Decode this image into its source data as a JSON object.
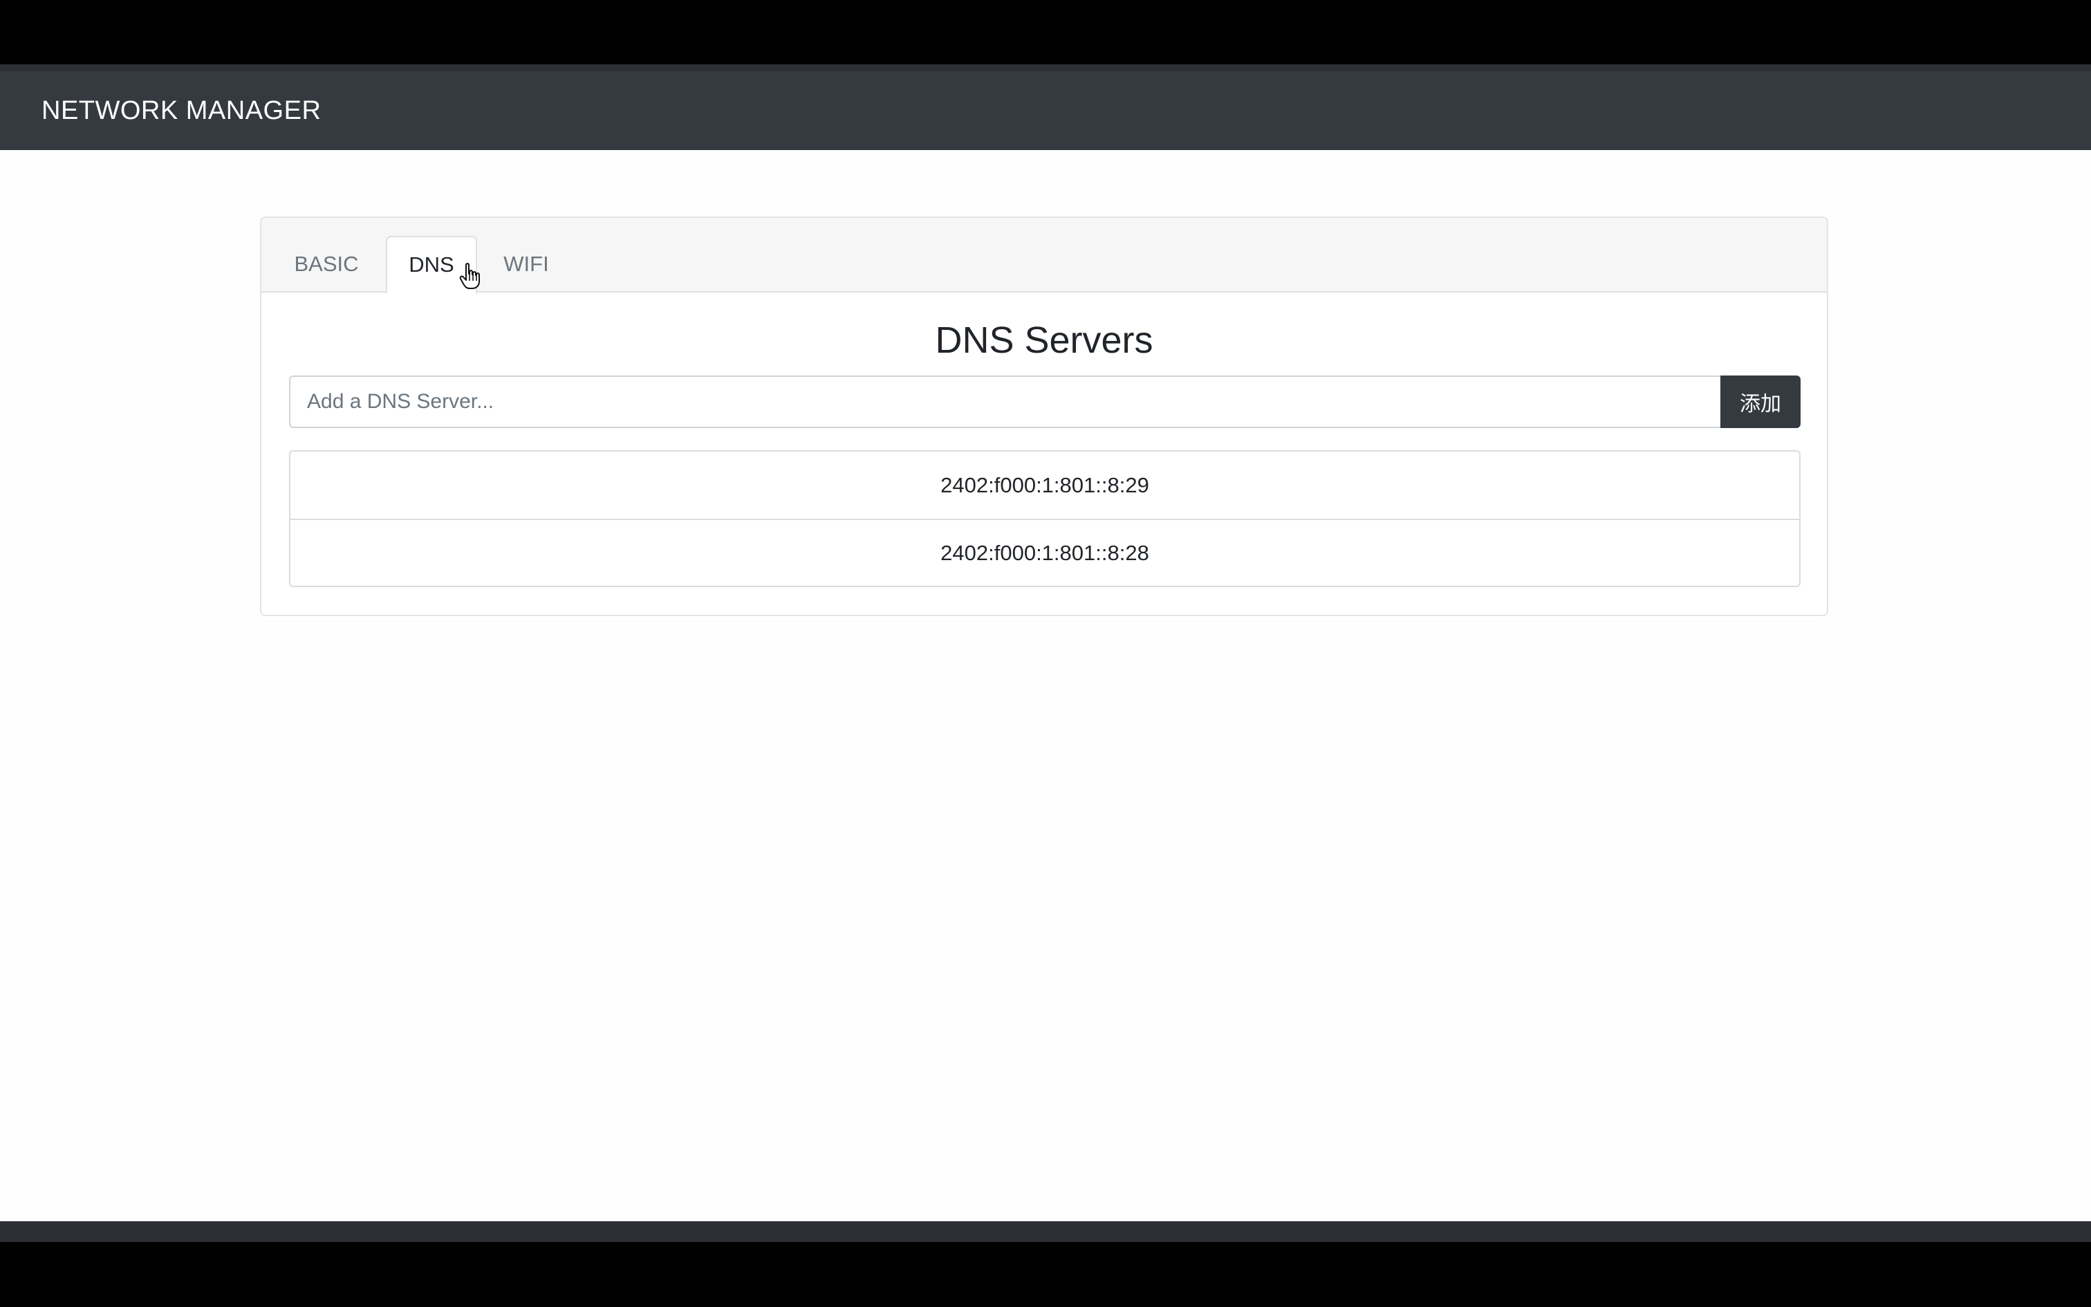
{
  "navbar": {
    "brand": "NETWORK MANAGER"
  },
  "tabs": [
    {
      "label": "BASIC",
      "active": false
    },
    {
      "label": "DNS",
      "active": true
    },
    {
      "label": "WIFI",
      "active": false
    }
  ],
  "dns": {
    "title": "DNS Servers",
    "input_placeholder": "Add a DNS Server...",
    "input_value": "",
    "add_button_label": "添加",
    "servers": [
      "2402:f000:1:801::8:29",
      "2402:f000:1:801::8:28"
    ]
  },
  "colors": {
    "navbar_bg": "#343a40",
    "button_bg": "#343a40",
    "page_bg": "#fefefe"
  },
  "cursor": {
    "icon": "hand-pointer-icon"
  }
}
